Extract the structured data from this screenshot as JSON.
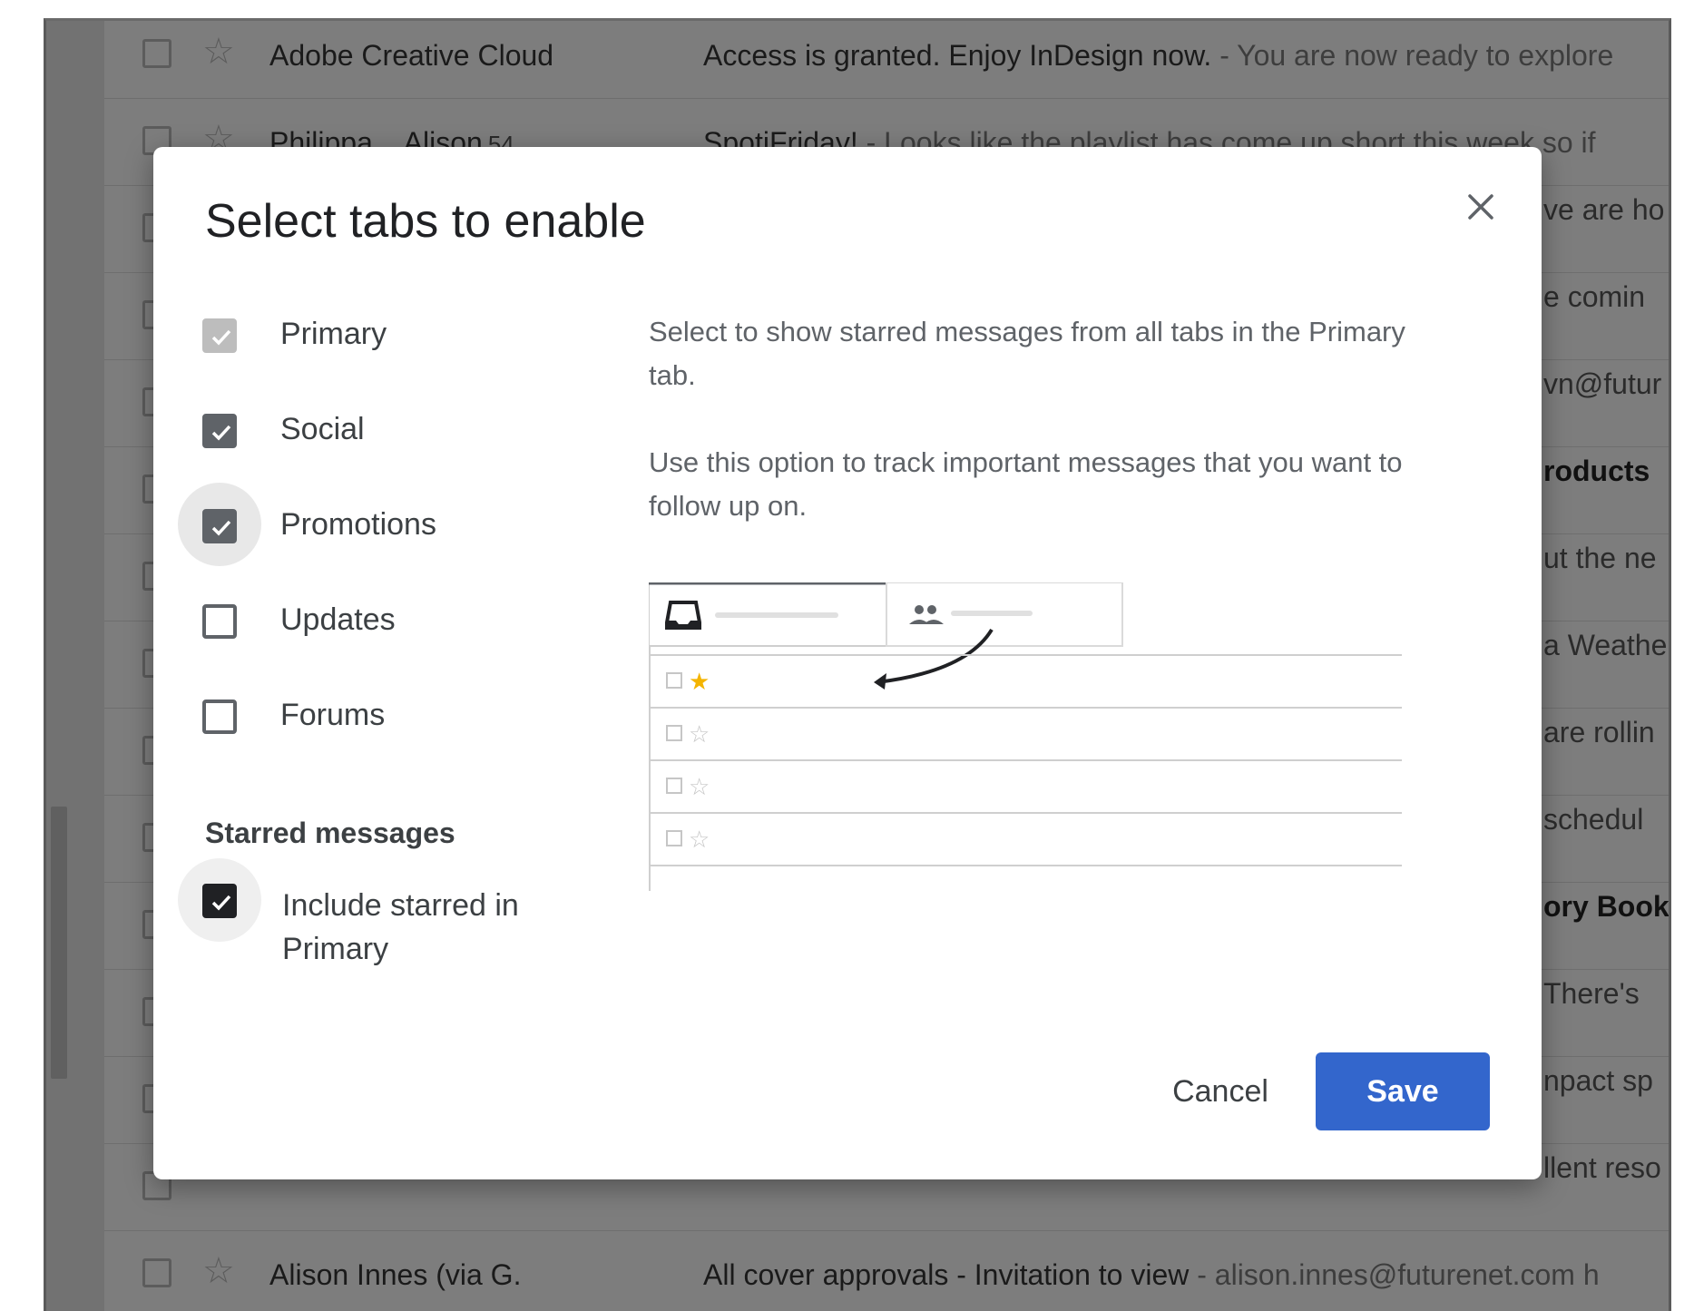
{
  "inbox": {
    "rows": [
      {
        "sender": "Adobe Creative Cloud",
        "count": "",
        "subject": "Access is granted. Enjoy InDesign now.",
        "snippet": " - You are now ready to explore"
      },
      {
        "sender": "Philippa .. Alison",
        "count": "54",
        "subject": "SpotiFriday!",
        "snippet": " - Looks like the playlist has come up short this week so if"
      },
      {
        "sender": "Alison Innes (via G.",
        "count": "",
        "subject": "All cover approvals - Invitation to view",
        "snippet": " - alison.innes@futurenet.com h"
      }
    ],
    "right_fragments": [
      {
        "text": "ve are ho",
        "bold": false
      },
      {
        "text": "e comin",
        "bold": false
      },
      {
        "text": "vn@futur",
        "bold": false
      },
      {
        "text": "roducts",
        "bold": true
      },
      {
        "text": "ut the ne",
        "bold": false
      },
      {
        "text": "a Weathe",
        "bold": false
      },
      {
        "text": "are rollin",
        "bold": false
      },
      {
        "text": "schedul",
        "bold": false
      },
      {
        "text": "ory Book",
        "bold": true
      },
      {
        "text": "There's",
        "bold": false
      },
      {
        "text": "npact sp",
        "bold": false
      },
      {
        "text": "llent reso",
        "bold": false
      }
    ]
  },
  "dialog": {
    "title": "Select tabs to enable",
    "tabs": [
      {
        "label": "Primary",
        "checked": true
      },
      {
        "label": "Social",
        "checked": true
      },
      {
        "label": "Promotions",
        "checked": true
      },
      {
        "label": "Updates",
        "checked": false
      },
      {
        "label": "Forums",
        "checked": false
      }
    ],
    "starred_heading": "Starred messages",
    "starred_option": {
      "label": "Include starred in Primary",
      "checked": true
    },
    "description_1": "Select to show starred messages from all tabs in the Primary tab.",
    "description_2": "Use this option to track important messages that you want to follow up on.",
    "cancel_label": "Cancel",
    "save_label": "Save"
  },
  "colors": {
    "save_button": "#3366cc",
    "star_highlight": "#f4b400",
    "overlay": "#7d7d7d"
  }
}
